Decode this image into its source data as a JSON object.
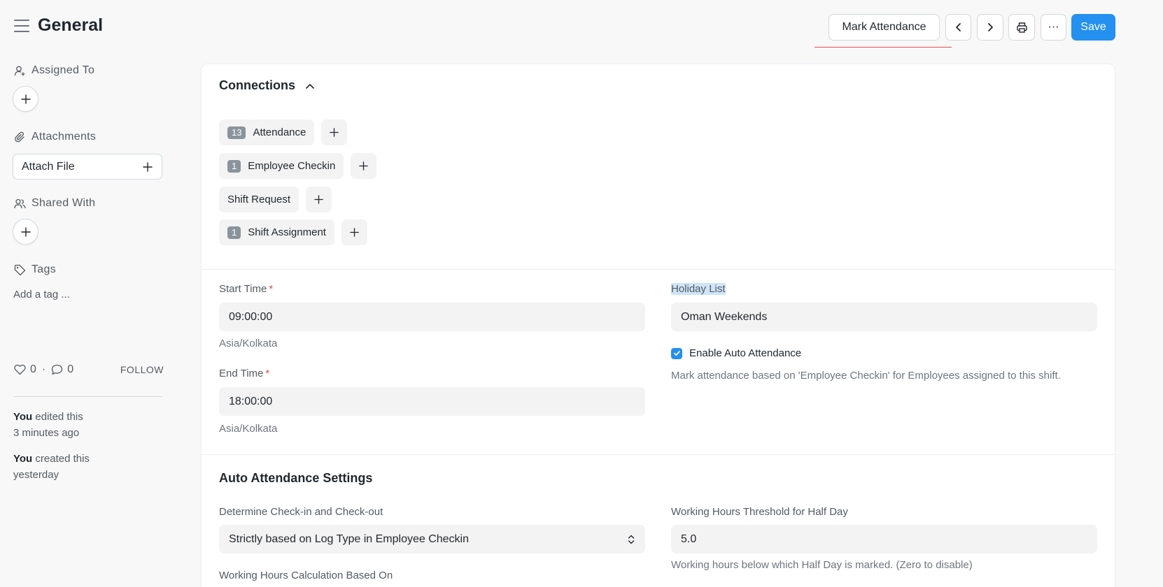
{
  "header": {
    "title": "General",
    "buttons": {
      "mark_attendance": "Mark Attendance",
      "more": "···",
      "save": "Save"
    }
  },
  "sidebar": {
    "assigned_to": "Assigned To",
    "attachments": "Attachments",
    "attach_file": "Attach File",
    "shared_with": "Shared With",
    "tags": "Tags",
    "add_tag": "Add a tag ...",
    "likes": "0",
    "dot": "·",
    "comments": "0",
    "follow": "FOLLOW",
    "activity": [
      {
        "who": "You",
        "text": " edited this",
        "when": "3 minutes ago"
      },
      {
        "who": "You",
        "text": " created this",
        "when": "yesterday"
      }
    ]
  },
  "connections": {
    "title": "Connections",
    "items": [
      {
        "count": "13",
        "label": "Attendance"
      },
      {
        "count": "1",
        "label": "Employee Checkin"
      },
      {
        "count": "",
        "label": "Shift Request"
      },
      {
        "count": "1",
        "label": "Shift Assignment"
      }
    ]
  },
  "form": {
    "start_time": {
      "label": "Start Time",
      "required": "*",
      "value": "09:00:00",
      "helper": "Asia/Kolkata"
    },
    "end_time": {
      "label": "End Time",
      "required": "*",
      "value": "18:00:00",
      "helper": "Asia/Kolkata"
    },
    "holiday_list": {
      "label": "Holiday List",
      "value": "Oman Weekends"
    },
    "enable_auto_attendance": {
      "label": "Enable Auto Attendance",
      "checked": true,
      "helper": "Mark attendance based on 'Employee Checkin' for Employees assigned to this shift."
    }
  },
  "auto_attendance": {
    "title": "Auto Attendance Settings",
    "determine": {
      "label": "Determine Check-in and Check-out",
      "value": "Strictly based on Log Type in Employee Checkin"
    },
    "threshold": {
      "label": "Working Hours Threshold for Half Day",
      "value": "5.0",
      "helper": "Working hours below which Half Day is marked. (Zero to disable)"
    },
    "calc_based_on": {
      "label": "Working Hours Calculation Based On"
    }
  },
  "colors": {
    "primary": "#2490ef",
    "required": "#e24c4c"
  }
}
